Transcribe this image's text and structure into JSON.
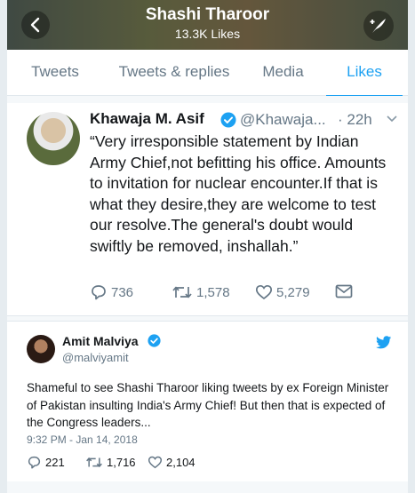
{
  "header": {
    "title": "Shashi Tharoor",
    "subtitle": "13.3K Likes"
  },
  "tabs": [
    {
      "label": "Tweets"
    },
    {
      "label": "Tweets & replies"
    },
    {
      "label": "Media"
    },
    {
      "label": "Likes",
      "active": true
    }
  ],
  "tweet1": {
    "name": "Khawaja M. Asif",
    "handle": "@Khawaja...",
    "time": "· 22h",
    "text": "“Very irresponsible statement by Indian Army Chief,not befitting his office. Amounts to invitation for nuclear encounter.If that is what they desire,they are welcome to test our resolve.The general's doubt would swiftly be removed, inshallah.”",
    "replies": "736",
    "retweets": "1,578",
    "likes": "5,279"
  },
  "tweet2": {
    "name": "Amit Malviya",
    "handle": "@malviyamit",
    "text": "Shameful to see Shashi Tharoor liking tweets by ex Foreign Minister of Pakistan insulting India's Army Chief! But then that is expected of the Congress leaders...",
    "timestamp": "9:32 PM - Jan 14, 2018",
    "replies": "221",
    "retweets": "1,716",
    "likes": "2,104"
  },
  "icons": {
    "back": "chevron-left-icon",
    "compose": "compose-icon",
    "verified": "verified-badge-icon",
    "twitter": "twitter-bird-icon",
    "reply": "reply-icon",
    "retweet": "retweet-icon",
    "like": "heart-icon",
    "message": "envelope-icon",
    "caret": "chevron-down-icon"
  },
  "colors": {
    "accent": "#1da1f2",
    "muted": "#657786",
    "text": "#14171a"
  }
}
